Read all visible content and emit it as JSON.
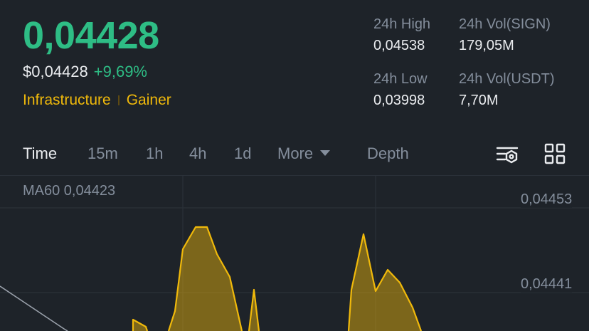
{
  "header": {
    "price": "0,04428",
    "price_usd": "$0,04428",
    "change": "+9,69%",
    "tags": [
      "Infrastructure",
      "Gainer"
    ]
  },
  "stats": {
    "high_label": "24h High",
    "high_value": "0,04538",
    "vol_sign_label": "24h Vol(SIGN)",
    "vol_sign_value": "179,05M",
    "low_label": "24h Low",
    "low_value": "0,03998",
    "vol_usdt_label": "24h Vol(USDT)",
    "vol_usdt_value": "7,70M"
  },
  "toolbar": {
    "time": "Time",
    "m15": "15m",
    "h1": "1h",
    "h4": "4h",
    "d1": "1d",
    "more": "More",
    "depth": "Depth",
    "chart_settings_icon": "chart-settings-icon",
    "layout_icon": "grid-layout-icon"
  },
  "chart": {
    "ma_label": "MA60 0,04423",
    "y_labels": [
      "0,04453",
      "0,04441"
    ]
  },
  "colors": {
    "up": "#2ebd85",
    "accent": "#f0b90b",
    "text_secondary": "#848e9c",
    "text_primary": "#eaecef",
    "background": "#1e2329"
  }
}
